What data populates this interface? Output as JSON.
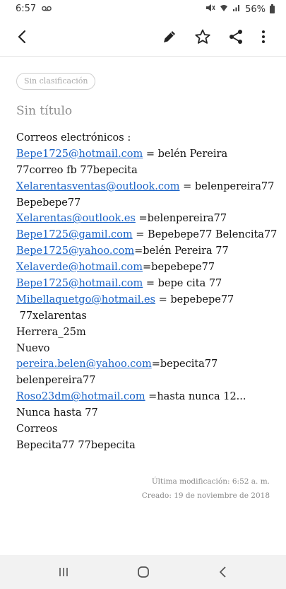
{
  "status_bar": {
    "time": "6:57",
    "voicemail_icon": "voicemail-icon",
    "battery": "56%",
    "icons": [
      "mute-icon",
      "wifi-icon",
      "signal-icon",
      "battery-icon"
    ]
  },
  "toolbar": {
    "icons": [
      "back-arrow-icon",
      "pencil-icon",
      "star-icon",
      "share-icon",
      "more-vert-icon"
    ]
  },
  "note": {
    "category": "Sin clasificación",
    "title": "Sin título",
    "lines": [
      {
        "text": "Correos electrónicos :"
      },
      {
        "link": "Bepe1725@hotmail.com",
        "text": " = belén Pereira"
      },
      {
        "text": "77correo fb 77bepecita"
      },
      {
        "link": "Xelarentasventas@outlook.com",
        "text": " = belenpereira77"
      },
      {
        "text": "Bepebepe77"
      },
      {
        "link": "Xelarentas@outlook.es",
        "text": " =belenpereira77"
      },
      {
        "link": "Bepe1725@gamil.com",
        "text": " = Bepebepe77 Belencita77"
      },
      {
        "link": "Bepe1725@yahoo.com",
        "text": "=belén Pereira 77"
      },
      {
        "link": "Xelaverde@hotmail.com",
        "text": "=bepebepe77"
      },
      {
        "link": "Bepe1725@hotmail.com",
        "text": " = bepe cita 77"
      },
      {
        "link": "Mibellaquetgo@hotmail.es",
        "text": " = bepebepe77"
      },
      {
        "text": " 77xelarentas"
      },
      {
        "text": "Herrera_25m"
      },
      {
        "text": "Nuevo"
      },
      {
        "link": "pereira.belen@yahoo.com",
        "text": "=bepecita77"
      },
      {
        "text": "belenpereira77"
      },
      {
        "link": "Roso23dm@hotmail.com",
        "text": " =hasta nunca 12..."
      },
      {
        "text": "Nunca hasta 77"
      },
      {
        "text": "Correos"
      },
      {
        "text": "Bepecita77 77bepecita"
      }
    ],
    "last_modified": "Última modificación: 6:52 a. m.",
    "created": "Creado: 19 de noviembre de 2018"
  },
  "nav_bar": {
    "icons": [
      "recents-icon",
      "home-icon",
      "back-icon"
    ]
  },
  "colors": {
    "link": "#1a63c7",
    "title_gray": "#8e8e8e",
    "nav_bg": "#f2f2f2"
  }
}
